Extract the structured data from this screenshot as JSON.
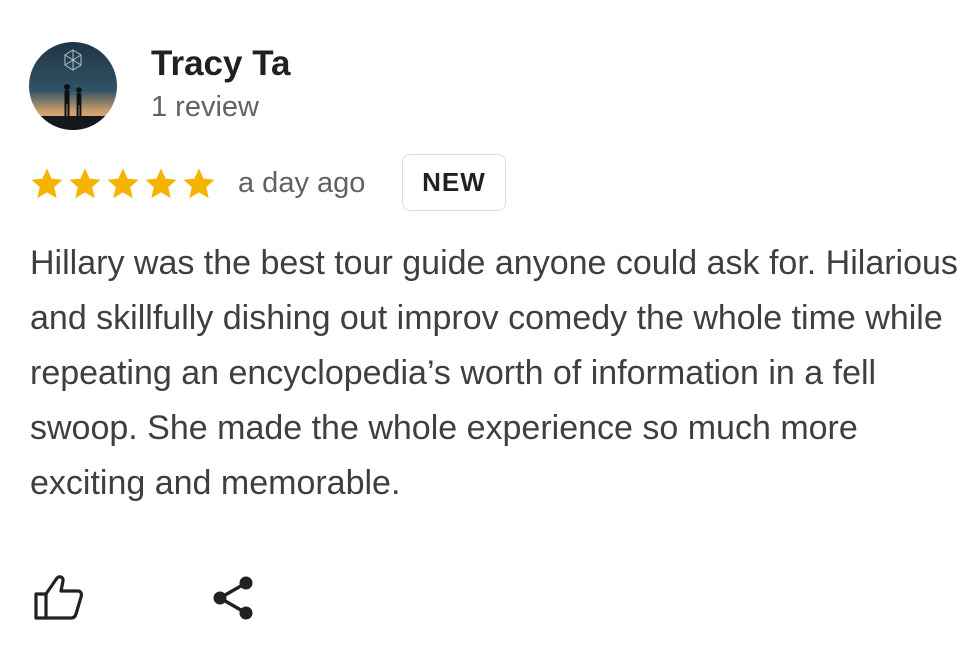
{
  "reviewer": {
    "name": "Tracy Ta",
    "review_count": "1 review",
    "avatar_icon": "profile-photo-silhouettes-icon"
  },
  "rating": {
    "stars": 5,
    "max": 5,
    "star_color": "#f4b400"
  },
  "timestamp": "a day ago",
  "badge": "NEW",
  "review_text": "Hillary was the best tour guide anyone could ask for. Hilarious and skillfully dishing out improv comedy the whole time while repeating an encyclopedia’s worth of information in a fell swoop. She made the whole experience so much more exciting and memorable.",
  "actions": {
    "like_icon": "thumbs-up-icon",
    "share_icon": "share-icon"
  },
  "colors": {
    "name": "#202124",
    "secondary_text": "#5f6368",
    "body_text": "#3c4043",
    "badge_border": "#dadce0"
  }
}
